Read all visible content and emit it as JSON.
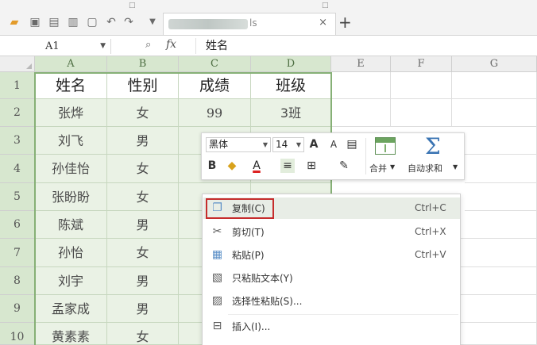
{
  "toolbar": {
    "icons": [
      "folder-open-icon",
      "save-icon",
      "print-preview-icon",
      "print-icon",
      "export-icon",
      "undo-icon",
      "redo-icon",
      "dropdown-arrow-icon"
    ],
    "tab": {
      "title_visible": "ls",
      "close_glyph": "×"
    },
    "add_tab_glyph": "+"
  },
  "formula_bar": {
    "cell_reference": "A1",
    "fx_label": "fx",
    "value": "姓名"
  },
  "sheet": {
    "columns": [
      "A",
      "B",
      "C",
      "D",
      "E",
      "F",
      "G"
    ],
    "rows": [
      "1",
      "2",
      "3",
      "4",
      "5",
      "6",
      "7",
      "8",
      "9",
      "10"
    ],
    "header": [
      "姓名",
      "性别",
      "成绩",
      "班级"
    ],
    "data": [
      [
        "张烨",
        "女",
        "99",
        "3班"
      ],
      [
        "刘飞",
        "男",
        "",
        ""
      ],
      [
        "孙佳怡",
        "女",
        "",
        ""
      ],
      [
        "张盼盼",
        "女",
        "",
        ""
      ],
      [
        "陈斌",
        "男",
        "",
        ""
      ],
      [
        "孙怡",
        "女",
        "",
        ""
      ],
      [
        "刘宇",
        "男",
        "",
        ""
      ],
      [
        "孟家成",
        "男",
        "",
        ""
      ],
      [
        "黄素素",
        "女",
        "",
        ""
      ]
    ],
    "selection_color": "#86b076"
  },
  "mini_toolbar": {
    "font_name": "黑体",
    "font_size": "14",
    "grow_font": "A",
    "shrink_font": "A",
    "bold": "B",
    "font_color": "A",
    "merge_label": "合并",
    "autosum_label": "自动求和",
    "sum_glyph": "Σ"
  },
  "context_menu": {
    "items": [
      {
        "label": "复制(C)",
        "shortcut": "Ctrl+C",
        "icon": "copy-icon"
      },
      {
        "label": "剪切(T)",
        "shortcut": "Ctrl+X",
        "icon": "scissors-icon"
      },
      {
        "label": "粘贴(P)",
        "shortcut": "Ctrl+V",
        "icon": "paste-icon"
      },
      {
        "label": "只粘贴文本(Y)",
        "shortcut": "",
        "icon": "paste-text-icon"
      },
      {
        "label": "选择性粘贴(S)...",
        "shortcut": "",
        "icon": "paste-special-icon"
      },
      {
        "label": "插入(I)...",
        "shortcut": "",
        "icon": "insert-icon"
      }
    ],
    "highlight_color": "#c62c2c"
  }
}
